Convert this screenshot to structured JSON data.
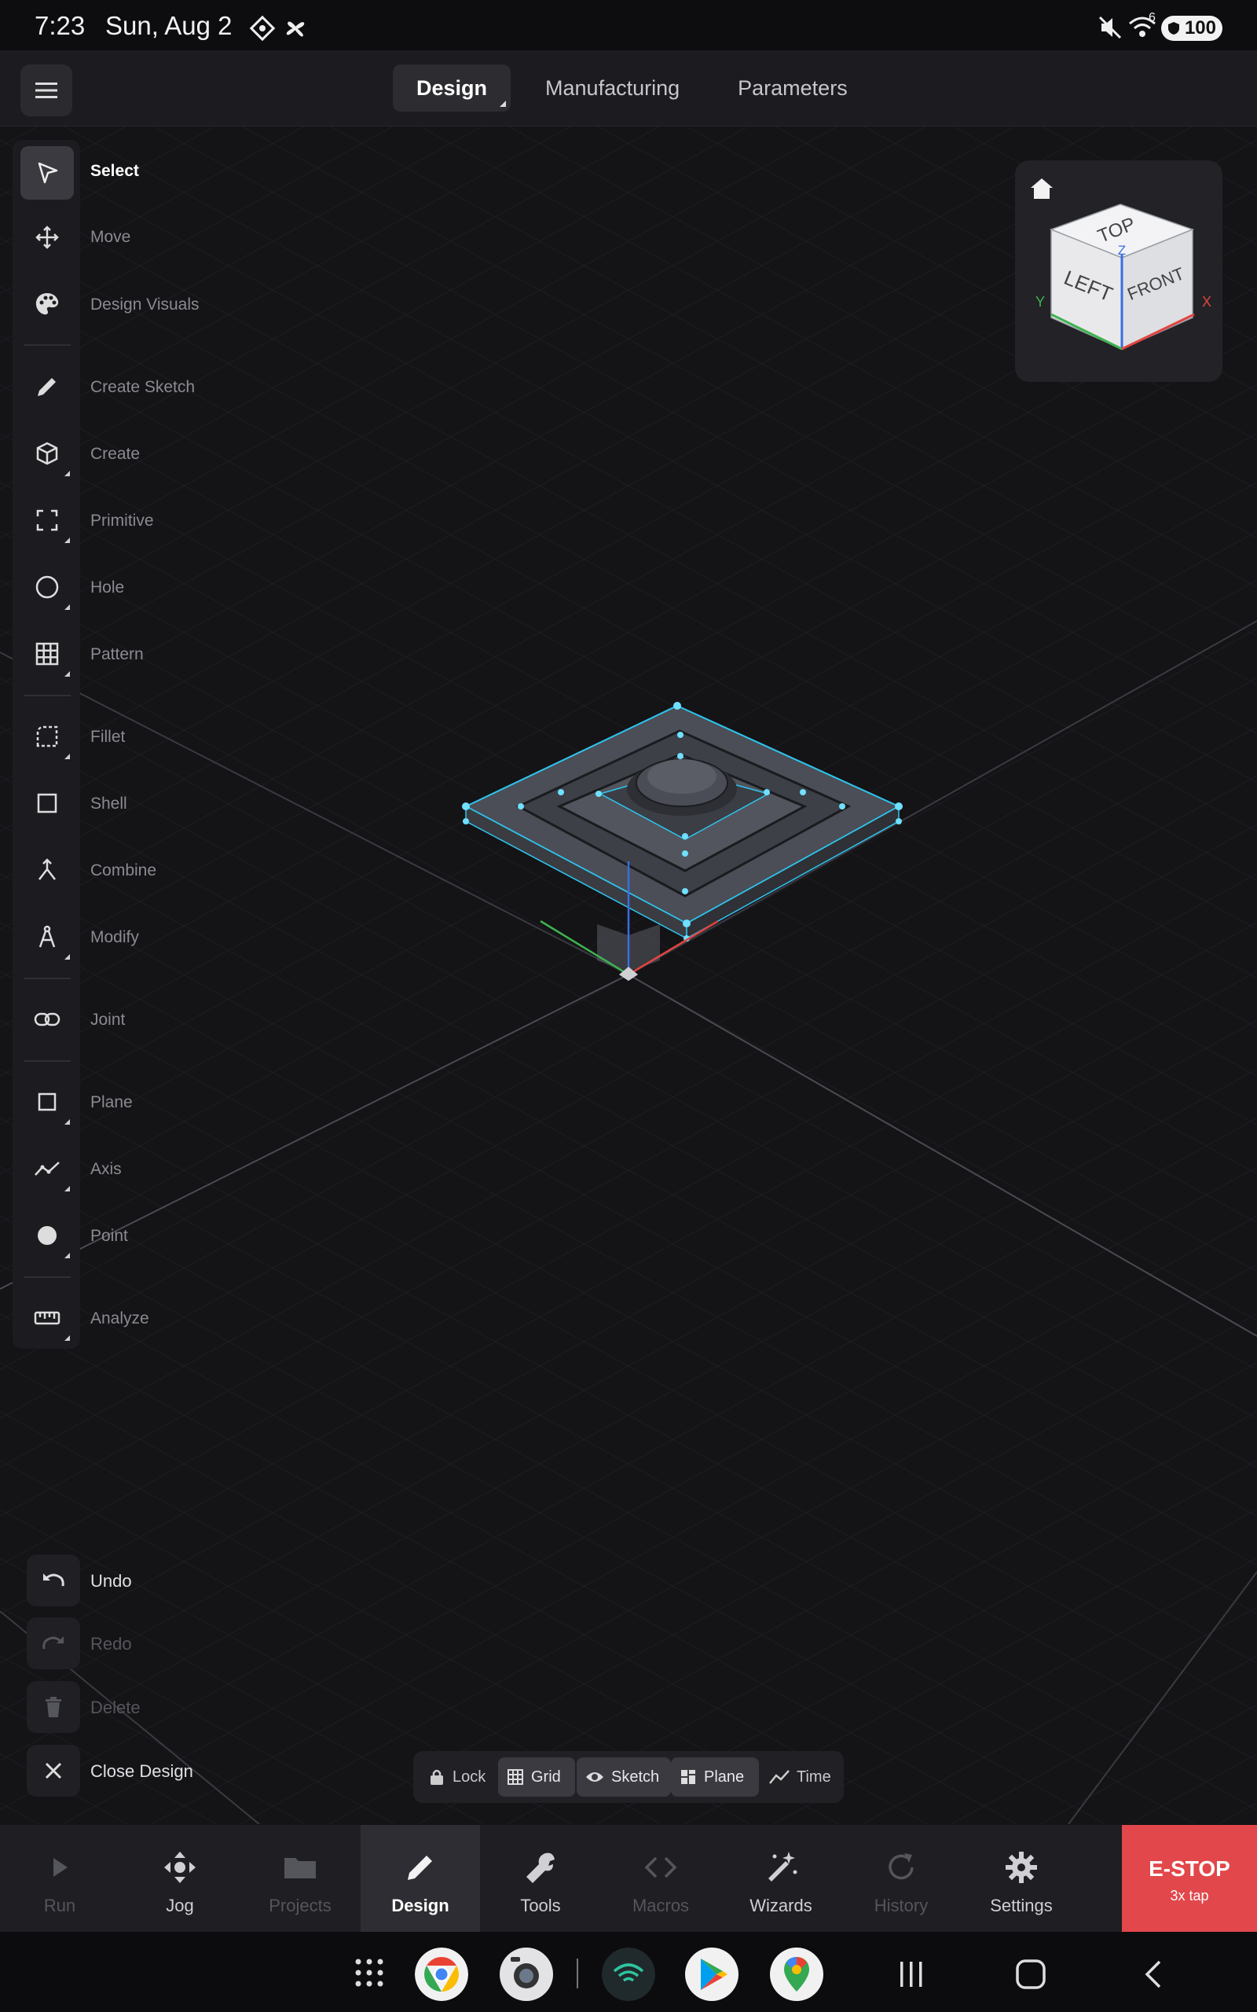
{
  "status_bar": {
    "time": "7:23",
    "date": "Sun, Aug 2",
    "battery": "100",
    "signal_label": "6"
  },
  "header": {
    "tabs": [
      {
        "label": "Design",
        "active": true
      },
      {
        "label": "Manufacturing",
        "active": false
      },
      {
        "label": "Parameters",
        "active": false
      }
    ]
  },
  "toolbar": {
    "items": [
      {
        "label": "Select",
        "icon": "cursor-icon"
      },
      {
        "label": "Move",
        "icon": "move-arrows-icon"
      },
      {
        "label": "Design Visuals",
        "icon": "palette-icon"
      },
      {
        "label": "Create Sketch",
        "icon": "pencil-icon"
      },
      {
        "label": "Create",
        "icon": "cube-icon"
      },
      {
        "label": "Primitive",
        "icon": "frame-corners-icon"
      },
      {
        "label": "Hole",
        "icon": "circle-icon"
      },
      {
        "label": "Pattern",
        "icon": "grid-icon"
      },
      {
        "label": "Fillet",
        "icon": "fillet-icon"
      },
      {
        "label": "Shell",
        "icon": "square-icon"
      },
      {
        "label": "Combine",
        "icon": "merge-icon"
      },
      {
        "label": "Modify",
        "icon": "compass-icon"
      },
      {
        "label": "Joint",
        "icon": "link-icon"
      },
      {
        "label": "Plane",
        "icon": "plane-square-icon"
      },
      {
        "label": "Axis",
        "icon": "axis-line-icon"
      },
      {
        "label": "Point",
        "icon": "point-dot-icon"
      },
      {
        "label": "Analyze",
        "icon": "ruler-icon"
      }
    ]
  },
  "actions": {
    "undo": "Undo",
    "redo": "Redo",
    "delete": "Delete",
    "close_design": "Close Design"
  },
  "view_cube": {
    "top": "TOP",
    "left": "LEFT",
    "front": "FRONT",
    "axis_x": "X",
    "axis_y": "Y",
    "axis_z": "Z"
  },
  "view_toggles": {
    "lock": "Lock",
    "grid": "Grid",
    "sketch": "Sketch",
    "plane": "Plane",
    "time": "Time"
  },
  "bottom_nav": {
    "items": [
      {
        "label": "Run",
        "enabled": false
      },
      {
        "label": "Jog",
        "enabled": true
      },
      {
        "label": "Projects",
        "enabled": false
      },
      {
        "label": "Design",
        "enabled": true,
        "active": true
      },
      {
        "label": "Tools",
        "enabled": true
      },
      {
        "label": "Macros",
        "enabled": false
      },
      {
        "label": "Wizards",
        "enabled": true
      },
      {
        "label": "History",
        "enabled": false
      },
      {
        "label": "Settings",
        "enabled": true
      }
    ],
    "estop_label": "E-STOP",
    "estop_sub": "3x tap"
  },
  "colors": {
    "accent_estop": "#e2474b",
    "selection_cyan": "#2ec5f0",
    "axis_x": "#e0453f",
    "axis_y": "#3fb34f",
    "axis_z": "#3a6ee0"
  }
}
